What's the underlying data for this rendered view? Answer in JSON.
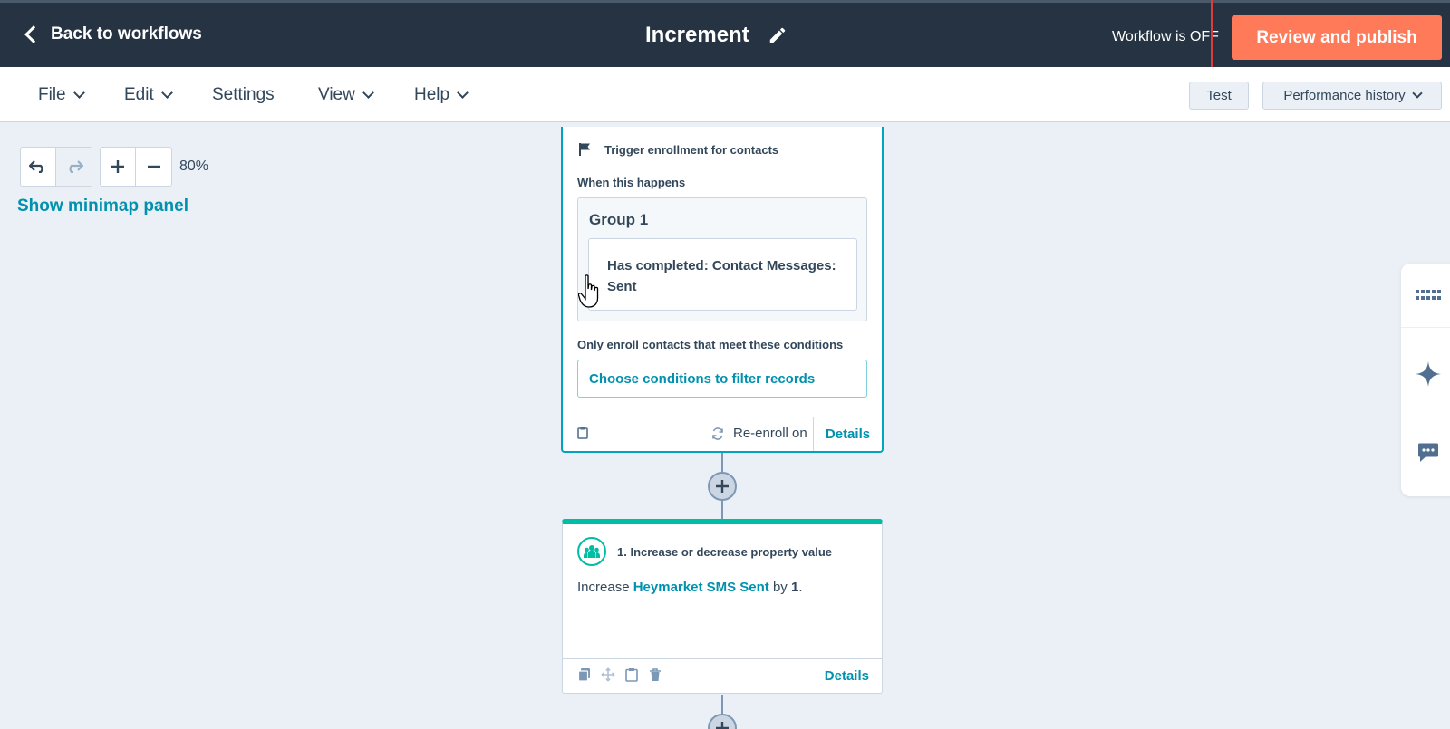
{
  "topbar": {
    "back_label": "Back to workflows",
    "title": "Increment",
    "status": "Workflow is OFF",
    "publish_label": "Review and publish"
  },
  "menu": {
    "items": [
      {
        "label": "File",
        "has_dropdown": true
      },
      {
        "label": "Edit",
        "has_dropdown": true
      },
      {
        "label": "Settings",
        "has_dropdown": false
      },
      {
        "label": "View",
        "has_dropdown": true
      },
      {
        "label": "Help",
        "has_dropdown": true
      }
    ],
    "test_label": "Test",
    "history_label": "Performance history"
  },
  "canvas": {
    "zoom_level": "80%",
    "minimap_label": "Show minimap panel"
  },
  "trigger": {
    "heading": "Trigger enrollment for contacts",
    "when_label": "When this happens",
    "group_title": "Group 1",
    "filter_text": "Has completed: Contact Messages: Sent",
    "only_enroll_label": "Only enroll contacts that meet these conditions",
    "choose_conditions": "Choose conditions to filter records",
    "reenroll_label": "Re-enroll on",
    "details_label": "Details"
  },
  "action": {
    "heading": "1. Increase or decrease property value",
    "verb": "Increase",
    "property": "Heymarket SMS Sent",
    "by_word": "by",
    "amount": "1",
    "period": ".",
    "details_label": "Details"
  },
  "colors": {
    "topbar": "#253342",
    "publish": "#ff7a59",
    "link": "#0091ae",
    "trigger_border": "#00a4bd",
    "action_accent": "#00bda5",
    "highlight": "#e03a3a"
  }
}
